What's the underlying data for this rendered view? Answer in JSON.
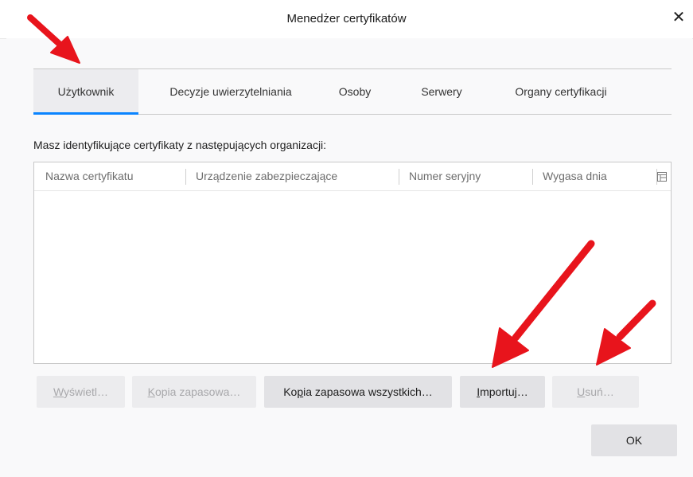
{
  "dialog": {
    "title": "Menedżer certyfikatów",
    "close_glyph": "✕"
  },
  "tabs": [
    {
      "label": "Użytkownik",
      "selected": true
    },
    {
      "label": "Decyzje uwierzytelniania",
      "selected": false
    },
    {
      "label": "Osoby",
      "selected": false
    },
    {
      "label": "Serwery",
      "selected": false
    },
    {
      "label": "Organy certyfikacji",
      "selected": false
    }
  ],
  "intro_text": "Masz identyfikujące certyfikaty z następujących organizacji:",
  "table": {
    "columns": [
      "Nazwa certyfikatu",
      "Urządzenie zabezpieczające",
      "Numer seryjny",
      "Wygasa dnia"
    ],
    "rows": [],
    "column_picker_icon": "column-picker-icon"
  },
  "buttons": {
    "view": {
      "first": "W",
      "rest": "yświetl…",
      "enabled": false
    },
    "backup": {
      "first": "K",
      "rest": "opia zapasowa…",
      "enabled": false
    },
    "backup_all": {
      "first": "Ko",
      "underlined": "p",
      "rest": "ia zapasowa wszystkich…",
      "enabled": true
    },
    "import": {
      "first": "",
      "underlined": "I",
      "rest": "mportuj…",
      "enabled": true
    },
    "delete": {
      "first": "",
      "underlined": "U",
      "rest": "suń…",
      "enabled": false
    },
    "ok": {
      "label": "OK",
      "enabled": true
    }
  },
  "colors": {
    "accent": "#0a84ff",
    "annotation_arrow": "#e8141c"
  }
}
